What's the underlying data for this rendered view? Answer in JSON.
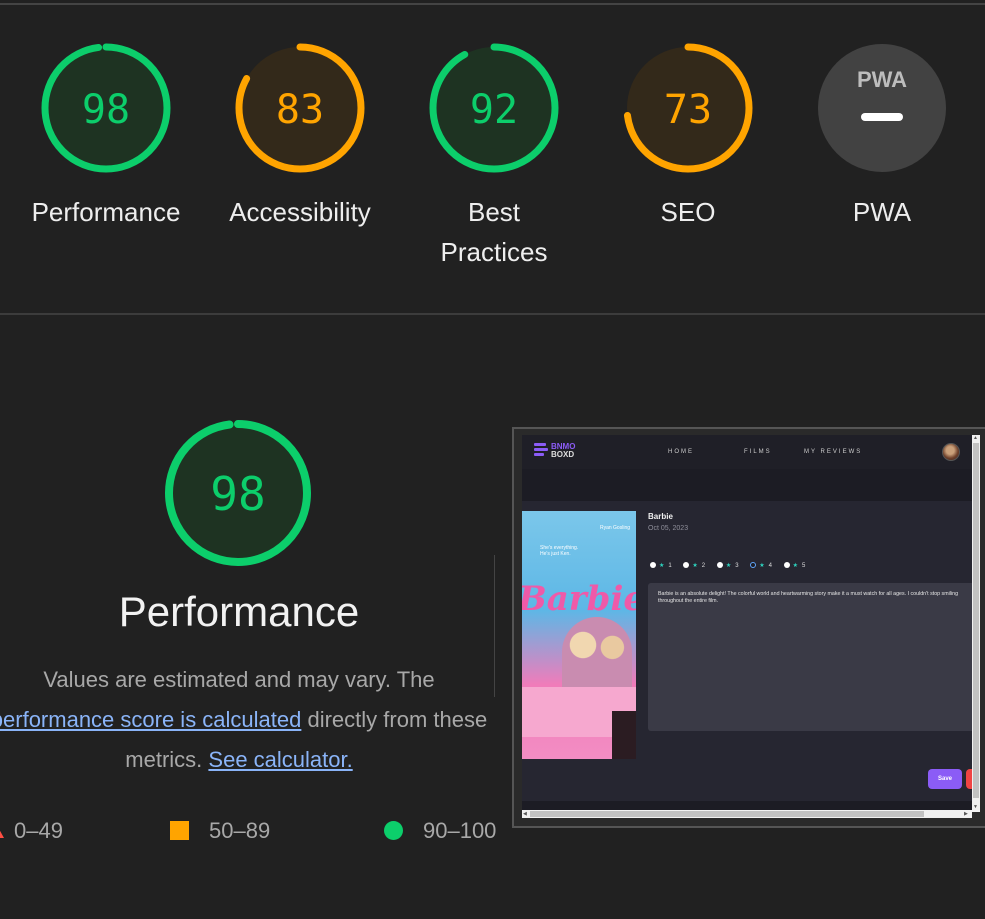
{
  "categories": [
    {
      "label": "Performance",
      "score": "98",
      "value": 98,
      "color": "#0cce6b",
      "fill": "#1e3322"
    },
    {
      "label": "Accessibility",
      "score": "83",
      "value": 83,
      "color": "#ffa400",
      "fill": "#33291a"
    },
    {
      "label": "Best Practices",
      "score": "92",
      "value": 92,
      "color": "#0cce6b",
      "fill": "#1e3322"
    },
    {
      "label": "SEO",
      "score": "73",
      "value": 73,
      "color": "#ffa400",
      "fill": "#33291a"
    },
    {
      "label": "PWA",
      "badge_text": "PWA",
      "badge_icon": "pwa-dash-icon"
    }
  ],
  "performance": {
    "score": "98",
    "value": 98,
    "title": "Performance",
    "desc_line1": "Values are estimated and may vary. The",
    "desc_link1": "performance score is calculated",
    "desc_after_link1": " directly from these",
    "desc_line3_pre": "metrics. ",
    "desc_link2": "See calculator."
  },
  "legend": {
    "fail": "0–49",
    "average": "50–89",
    "pass": "90–100"
  },
  "screenshot": {
    "brand_line1": "BNMO",
    "brand_line2": "BOXD",
    "nav": [
      "HOME",
      "FILMS",
      "MY REVIEWS"
    ],
    "movie_title": "Barbie",
    "movie_date": "Oct 05, 2023",
    "poster_text": "Barbie",
    "poster_tagline": "She's everything. He's just Ken.",
    "poster_name": "Ryan Gosling",
    "ratings": [
      "1",
      "2",
      "3",
      "4",
      "5"
    ],
    "selected_rating": "4",
    "review": "Barbie is an absolute delight! The colorful world and heartwarming story make it a must watch for all ages. I couldn't stop smiling throughout the entire film.",
    "save_label": "Save"
  },
  "colors": {
    "pass": "#0cce6b",
    "average": "#ffa400",
    "fail": "#ff4e42",
    "link": "#8ab4f8",
    "accent": "#8b5cf6"
  }
}
